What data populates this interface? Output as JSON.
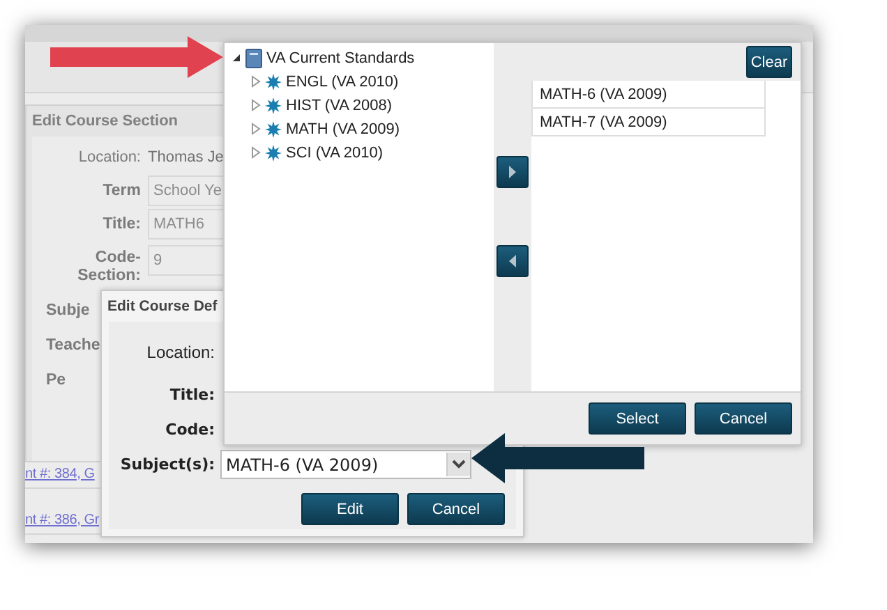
{
  "background_page": {
    "links": [
      "nt #: 384, G",
      "nt #: 386, Gr"
    ]
  },
  "course_section_panel": {
    "title": "Edit Course Section",
    "fields": [
      {
        "kind": "text",
        "label": "Location:",
        "value": "Thomas Je"
      },
      {
        "kind": "input",
        "label": "Term",
        "value": "School Ye",
        "disabled": true
      },
      {
        "kind": "input",
        "label": "Title:",
        "value": "MATH6",
        "disabled": true
      },
      {
        "kind": "input",
        "label": "Code-Section:",
        "value": "9",
        "disabled": true
      },
      {
        "kind": "cut",
        "label": "Subje"
      },
      {
        "kind": "cut",
        "label": "Teache"
      },
      {
        "kind": "cut",
        "label": "Pe"
      }
    ]
  },
  "course_definition_dialog": {
    "title": "Edit Course Def",
    "fields": [
      {
        "label": "Location:",
        "bold": false
      },
      {
        "label": "Title:",
        "bold": true
      },
      {
        "label": "Code:",
        "bold": true
      }
    ],
    "subjects": {
      "label": "Subject(s):",
      "value": "MATH-6 (VA 2009)"
    },
    "buttons": [
      "Edit",
      "Cancel"
    ]
  },
  "standards_picker": {
    "tree": {
      "label": "VA Current Standards",
      "expanded": true,
      "children": [
        {
          "label": "ENGL (VA 2010)",
          "expanded": false
        },
        {
          "label": "HIST (VA 2008)",
          "expanded": false
        },
        {
          "label": "MATH (VA 2009)",
          "expanded": false
        },
        {
          "label": "SCI (VA 2010)",
          "expanded": false
        }
      ]
    },
    "clear_button": "Clear",
    "selected_items": [
      "MATH-6 (VA 2009)",
      "MATH-7 (VA 2009)"
    ],
    "buttons": [
      "Select",
      "Cancel"
    ]
  }
}
